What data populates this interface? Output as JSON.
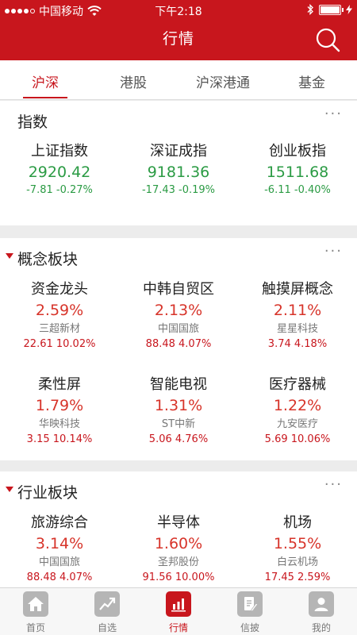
{
  "status_bar": {
    "carrier": "中国移动",
    "time": "下午2:18",
    "signal_bars": 4
  },
  "header": {
    "title": "行情",
    "search_icon": "search-icon"
  },
  "tabs": [
    {
      "label": "沪深",
      "active": true
    },
    {
      "label": "港股",
      "active": false
    },
    {
      "label": "沪深港通",
      "active": false
    },
    {
      "label": "基金",
      "active": false
    }
  ],
  "index_section": {
    "title": "指数",
    "more": "···",
    "items": [
      {
        "name": "上证指数",
        "value": "2920.42",
        "change": "-7.81 -0.27%"
      },
      {
        "name": "深证成指",
        "value": "9181.36",
        "change": "-17.43 -0.19%"
      },
      {
        "name": "创业板指",
        "value": "1511.68",
        "change": "-6.11 -0.40%"
      }
    ]
  },
  "concept_section": {
    "title": "概念板块",
    "more": "···",
    "items": [
      {
        "name": "资金龙头",
        "pct": "2.59%",
        "stock": "三超新材",
        "stock_line": "22.61 10.02%"
      },
      {
        "name": "中韩自贸区",
        "pct": "2.13%",
        "stock": "中国国旅",
        "stock_line": "88.48 4.07%"
      },
      {
        "name": "触摸屏概念",
        "pct": "2.11%",
        "stock": "星星科技",
        "stock_line": "3.74 4.18%"
      },
      {
        "name": "柔性屏",
        "pct": "1.79%",
        "stock": "华映科技",
        "stock_line": "3.15 10.14%"
      },
      {
        "name": "智能电视",
        "pct": "1.31%",
        "stock": "ST中新",
        "stock_line": "5.06 4.76%"
      },
      {
        "name": "医疗器械",
        "pct": "1.22%",
        "stock": "九安医疗",
        "stock_line": "5.69 10.06%"
      }
    ]
  },
  "industry_section": {
    "title": "行业板块",
    "more": "···",
    "items": [
      {
        "name": "旅游综合",
        "pct": "3.14%",
        "stock": "中国国旅",
        "stock_line": "88.48 4.07%"
      },
      {
        "name": "半导体",
        "pct": "1.60%",
        "stock": "圣邦股份",
        "stock_line": "91.56 10.00%"
      },
      {
        "name": "机场",
        "pct": "1.55%",
        "stock": "白云机场",
        "stock_line": "17.45 2.59%"
      }
    ]
  },
  "bottom_nav": [
    {
      "label": "首页",
      "icon": "home-icon",
      "active": false
    },
    {
      "label": "自选",
      "icon": "trend-icon",
      "active": false
    },
    {
      "label": "行情",
      "icon": "bar-chart-icon",
      "active": true
    },
    {
      "label": "信披",
      "icon": "document-edit-icon",
      "active": false
    },
    {
      "label": "我的",
      "icon": "user-icon",
      "active": false
    }
  ],
  "colors": {
    "brand": "#c8161d",
    "down": "#2b9b44",
    "up": "#d7342a"
  }
}
